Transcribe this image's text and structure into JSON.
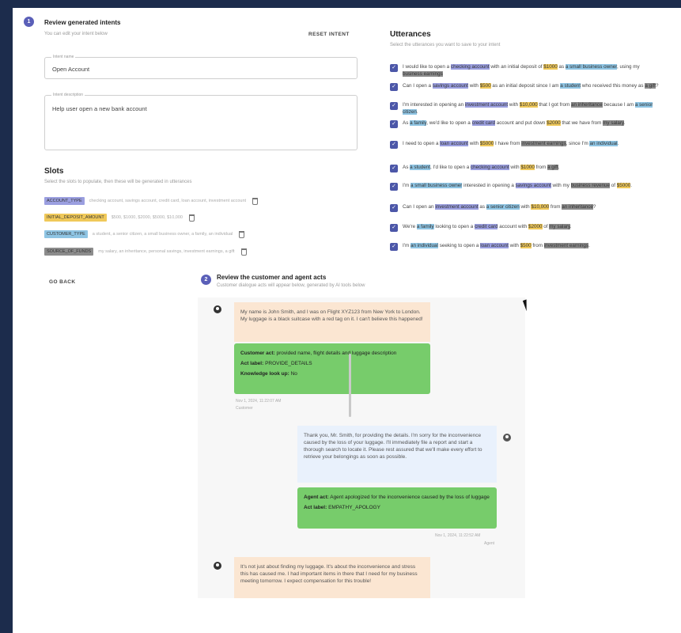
{
  "review_intents": {
    "step": "1",
    "title": "Review generated intents",
    "subtitle": "You can edit your intent below",
    "reset_label": "RESET INTENT",
    "intent_name_label": "Intent name",
    "intent_name_value": "Open Account",
    "intent_desc_label": "Intent description",
    "intent_desc_value": "Help user open a new bank account",
    "back_label": "GO BACK"
  },
  "slots": {
    "title": "Slots",
    "subtitle": "Select the slots to populate, then these will be generated in utterances",
    "items": [
      {
        "name": "ACCOUNT_TYPE",
        "examples": "checking account, savings account, credit card, loan account, investment account",
        "color": "#9b9fe0"
      },
      {
        "name": "INITIAL_DEPOSIT_AMOUNT",
        "examples": "$500, $1000, $2000, $5000, $10,000",
        "color": "#f0c95a"
      },
      {
        "name": "CUSTOMER_TYPE",
        "examples": "a student, a senior citizen, a small business owner, a family, an individual",
        "color": "#8fc5e4"
      },
      {
        "name": "SOURCE_OF_FUNDS",
        "examples": "my salary, an inheritance, personal savings, investment earnings, a gift",
        "color": "#8c8c8c"
      }
    ]
  },
  "utterances": {
    "title": "Utterances",
    "subtitle": "Select the utterances you want to save to your intent",
    "items": [
      {
        "parts": [
          [
            "I would like to open a ",
            ""
          ],
          [
            "checking account",
            "p"
          ],
          [
            " with an initial deposit of ",
            ""
          ],
          [
            "$1000",
            "y"
          ],
          [
            " as ",
            ""
          ],
          [
            "a small business owner",
            "b"
          ],
          [
            ", using my ",
            ""
          ],
          [
            "business earnings",
            "g"
          ]
        ]
      },
      {
        "parts": [
          [
            "Can I open a ",
            ""
          ],
          [
            "savings account",
            "p"
          ],
          [
            " with ",
            ""
          ],
          [
            "$500",
            "y"
          ],
          [
            " as an initial deposit since I am ",
            ""
          ],
          [
            "a student",
            "b"
          ],
          [
            " who received this money as ",
            ""
          ],
          [
            "a gift",
            "g"
          ],
          [
            "?",
            ""
          ]
        ]
      },
      {
        "parts": [
          [
            "I'm interested in opening an ",
            ""
          ],
          [
            "investment account",
            "p"
          ],
          [
            " with ",
            ""
          ],
          [
            "$10,000",
            "y"
          ],
          [
            " that I got from ",
            ""
          ],
          [
            "an inheritance",
            "g"
          ],
          [
            " because I am ",
            ""
          ],
          [
            "a senior citizen",
            "b"
          ],
          [
            ".",
            ""
          ]
        ]
      },
      {
        "parts": [
          [
            "As ",
            ""
          ],
          [
            "a family",
            "b"
          ],
          [
            ", we'd like to open a ",
            ""
          ],
          [
            "credit card",
            "p"
          ],
          [
            " account and put down ",
            ""
          ],
          [
            "$2000",
            "y"
          ],
          [
            " that we have from ",
            ""
          ],
          [
            "my salary",
            "g"
          ],
          [
            ".",
            ""
          ]
        ]
      },
      {
        "parts": [
          [
            "I need to open a ",
            ""
          ],
          [
            "loan account",
            "p"
          ],
          [
            " with ",
            ""
          ],
          [
            "$5000",
            "y"
          ],
          [
            " I have from ",
            ""
          ],
          [
            "investment earnings",
            "g"
          ],
          [
            ", since I'm ",
            ""
          ],
          [
            "an individual",
            "b"
          ],
          [
            ".",
            ""
          ]
        ]
      },
      {
        "parts": [
          [
            "As ",
            ""
          ],
          [
            "a student",
            "b"
          ],
          [
            ", I'd like to open a ",
            ""
          ],
          [
            "checking account",
            "p"
          ],
          [
            " with ",
            ""
          ],
          [
            "$1000",
            "y"
          ],
          [
            " from ",
            ""
          ],
          [
            "a gift",
            "g"
          ],
          [
            ".",
            ""
          ]
        ]
      },
      {
        "parts": [
          [
            "I'm ",
            ""
          ],
          [
            "a small business owner",
            "b"
          ],
          [
            " interested in opening a ",
            ""
          ],
          [
            "savings account",
            "p"
          ],
          [
            " with my ",
            ""
          ],
          [
            "business revenue",
            "g"
          ],
          [
            " of ",
            ""
          ],
          [
            "$5000",
            "y"
          ],
          [
            ".",
            ""
          ]
        ]
      },
      {
        "parts": [
          [
            "Can I open an ",
            ""
          ],
          [
            "investment account",
            "p"
          ],
          [
            " as ",
            ""
          ],
          [
            "a senior citizen",
            "b"
          ],
          [
            " with ",
            ""
          ],
          [
            "$10,000",
            "y"
          ],
          [
            " from ",
            ""
          ],
          [
            "an inheritance",
            "g"
          ],
          [
            "?",
            ""
          ]
        ]
      },
      {
        "parts": [
          [
            "We're ",
            ""
          ],
          [
            "a family",
            "b"
          ],
          [
            " looking to open a ",
            ""
          ],
          [
            "credit card",
            "p"
          ],
          [
            " account with ",
            ""
          ],
          [
            "$2000",
            "y"
          ],
          [
            " of ",
            ""
          ],
          [
            "my salary",
            "g"
          ],
          [
            ".",
            ""
          ]
        ]
      },
      {
        "parts": [
          [
            "I'm ",
            ""
          ],
          [
            "an individual",
            "b"
          ],
          [
            " seeking to open a ",
            ""
          ],
          [
            "loan account",
            "p"
          ],
          [
            " with ",
            ""
          ],
          [
            "$500",
            "y"
          ],
          [
            " from ",
            ""
          ],
          [
            "investment earnings",
            "g"
          ],
          [
            ".",
            ""
          ]
        ]
      }
    ]
  },
  "review_acts": {
    "step": "2",
    "title": "Review the customer and agent acts",
    "subtitle": "Customer dialogue acts will appear below, generated by AI tools below"
  },
  "chat": {
    "msg1": "My name is John Smith, and I was on Flight XYZ123 from New York to London. My luggage is a black suitcase with a red tag on it. I can't believe this happened!",
    "act1_label": "Customer act:",
    "act1_value": "provided name, flight details and luggage description",
    "act1_code_label": "Act label:",
    "act1_code_value": "PROVIDE_DETAILS",
    "act1_kb_label": "Knowledge look up:",
    "act1_kb_value": "No",
    "meta1": "Nov 1, 2024, 11:22:07 AM",
    "meta1b": "Customer",
    "msg2": "Thank you, Mr. Smith, for providing the details. I'm sorry for the inconvenience caused by the loss of your luggage. I'll immediately file a report and start a thorough search to locate it. Please rest assured that we'll make every effort to retrieve your belongings as soon as possible.",
    "act2_label": "Agent act:",
    "act2_value": "Agent apologized for the inconvenience caused by the loss of luggage",
    "act2_code_label": "Act label:",
    "act2_code_value": "EMPATHY_APOLOGY",
    "meta2": "Nov 1, 2024, 11:22:52 AM",
    "meta2b": "Agent",
    "msg3": "It's not just about finding my luggage. It's about the inconvenience and stress this has caused me. I had important items in there that I need for my business meeting tomorrow. I expect compensation for this trouble!"
  }
}
